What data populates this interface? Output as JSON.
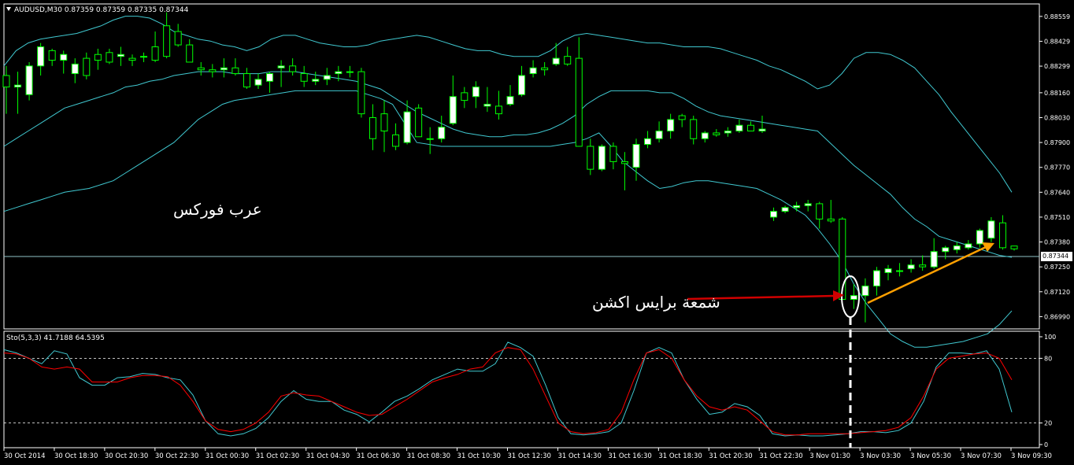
{
  "chart_header": {
    "symbol_info": "AUDUSD,M30  0.87359 0.87359 0.87335 0.87344"
  },
  "indicator_header": {
    "label": "Sto(5,3,3) 41.7188 64.5395"
  },
  "annotations": {
    "brand_text": "عرب فوركس",
    "price_action_label": "شمعة برايس اكشن"
  },
  "current_price_tag": "0.87344",
  "colors": {
    "background": "#000000",
    "bull_candle": "#ffffff",
    "bear_candle": "#000000",
    "wick": "#00ff00",
    "bollinger": "#40c8d0",
    "stoch_main": "#40c8d0",
    "stoch_signal": "#ff0000",
    "red_arrow": "#ff0000",
    "orange_arrow": "#ffa000",
    "grid_lines": "#ffffff"
  },
  "chart_data": [
    {
      "type": "candlestick",
      "title": "AUDUSD,M30",
      "y_ticks": [
        "0.88559",
        "0.88429",
        "0.88299",
        "0.88160",
        "0.88030",
        "0.87900",
        "0.87770",
        "0.87640",
        "0.87510",
        "0.87380",
        "0.87250",
        "0.87120",
        "0.86990"
      ],
      "ylim": [
        0.8693,
        0.8862
      ],
      "current_price": 0.87344,
      "x_tick_labels": [
        "30 Oct 2014",
        "30 Oct 18:30",
        "30 Oct 20:30",
        "30 Oct 22:30",
        "31 Oct 00:30",
        "31 Oct 02:30",
        "31 Oct 04:30",
        "31 Oct 06:30",
        "31 Oct 08:30",
        "31 Oct 10:30",
        "31 Oct 12:30",
        "31 Oct 14:30",
        "31 Oct 16:30",
        "31 Oct 18:30",
        "31 Oct 20:30",
        "31 Oct 22:30",
        "3 Nov 01:30",
        "3 Nov 03:30",
        "3 Nov 05:30",
        "3 Nov 07:30",
        "3 Nov 09:30"
      ],
      "candles": [
        [
          0.8825,
          0.883,
          0.8805,
          0.8819
        ],
        [
          0.8819,
          0.8827,
          0.8805,
          0.882
        ],
        [
          0.8815,
          0.8832,
          0.8812,
          0.883
        ],
        [
          0.883,
          0.8842,
          0.8825,
          0.884
        ],
        [
          0.8838,
          0.8839,
          0.883,
          0.8833
        ],
        [
          0.8833,
          0.8838,
          0.8826,
          0.8836
        ],
        [
          0.8826,
          0.8834,
          0.8821,
          0.8831
        ],
        [
          0.8834,
          0.8837,
          0.8823,
          0.8825
        ],
        [
          0.8836,
          0.8839,
          0.8828,
          0.8833
        ],
        [
          0.8837,
          0.8839,
          0.8831,
          0.8832
        ],
        [
          0.8835,
          0.884,
          0.883,
          0.8836
        ],
        [
          0.8834,
          0.8836,
          0.883,
          0.8833
        ],
        [
          0.8835,
          0.8837,
          0.8832,
          0.8835
        ],
        [
          0.884,
          0.8848,
          0.8832,
          0.8833
        ],
        [
          0.8851,
          0.8858,
          0.8834,
          0.8835
        ],
        [
          0.8848,
          0.8852,
          0.884,
          0.8841
        ],
        [
          0.8841,
          0.8844,
          0.8832,
          0.8832
        ],
        [
          0.8829,
          0.8832,
          0.8825,
          0.8828
        ],
        [
          0.8828,
          0.8831,
          0.8824,
          0.8827
        ],
        [
          0.8828,
          0.8834,
          0.8824,
          0.8829
        ],
        [
          0.8829,
          0.8834,
          0.8825,
          0.8826
        ],
        [
          0.8826,
          0.8829,
          0.8818,
          0.8819
        ],
        [
          0.882,
          0.8826,
          0.8818,
          0.8823
        ],
        [
          0.8822,
          0.8827,
          0.8816,
          0.8826
        ],
        [
          0.8829,
          0.8833,
          0.8819,
          0.883
        ],
        [
          0.883,
          0.8834,
          0.8825,
          0.8827
        ],
        [
          0.8826,
          0.883,
          0.8819,
          0.8822
        ],
        [
          0.8822,
          0.8827,
          0.882,
          0.8823
        ],
        [
          0.8823,
          0.8829,
          0.882,
          0.8825
        ],
        [
          0.8826,
          0.883,
          0.8822,
          0.8827
        ],
        [
          0.8827,
          0.883,
          0.8824,
          0.8827
        ],
        [
          0.8827,
          0.8829,
          0.8803,
          0.8805
        ],
        [
          0.8803,
          0.881,
          0.8786,
          0.8792
        ],
        [
          0.8805,
          0.8812,
          0.8785,
          0.8796
        ],
        [
          0.8794,
          0.88,
          0.8786,
          0.8788
        ],
        [
          0.879,
          0.8812,
          0.8789,
          0.8806
        ],
        [
          0.8808,
          0.881,
          0.8793,
          0.8793
        ],
        [
          0.8792,
          0.8798,
          0.8784,
          0.8792
        ],
        [
          0.8792,
          0.8804,
          0.879,
          0.8798
        ],
        [
          0.88,
          0.8825,
          0.8799,
          0.8814
        ],
        [
          0.8816,
          0.8819,
          0.8808,
          0.8812
        ],
        [
          0.8814,
          0.8822,
          0.8808,
          0.8819
        ],
        [
          0.8809,
          0.8819,
          0.8806,
          0.881
        ],
        [
          0.8809,
          0.8817,
          0.8802,
          0.8805
        ],
        [
          0.881,
          0.882,
          0.8809,
          0.8814
        ],
        [
          0.8815,
          0.883,
          0.8814,
          0.8825
        ],
        [
          0.8826,
          0.8833,
          0.8824,
          0.8829
        ],
        [
          0.8829,
          0.8832,
          0.8825,
          0.8828
        ],
        [
          0.8831,
          0.8842,
          0.883,
          0.8834
        ],
        [
          0.8835,
          0.884,
          0.883,
          0.8831
        ],
        [
          0.8834,
          0.8845,
          0.882,
          0.8788
        ],
        [
          0.8788,
          0.8792,
          0.8773,
          0.8776
        ],
        [
          0.8776,
          0.8789,
          0.8775,
          0.8788
        ],
        [
          0.8788,
          0.879,
          0.8776,
          0.878
        ],
        [
          0.878,
          0.8785,
          0.8765,
          0.8779
        ],
        [
          0.8777,
          0.8792,
          0.877,
          0.8789
        ],
        [
          0.8789,
          0.8796,
          0.8787,
          0.8792
        ],
        [
          0.8792,
          0.8801,
          0.879,
          0.8796
        ],
        [
          0.8796,
          0.8805,
          0.8792,
          0.8802
        ],
        [
          0.8804,
          0.8805,
          0.8798,
          0.8802
        ],
        [
          0.8802,
          0.8804,
          0.8789,
          0.8792
        ],
        [
          0.8792,
          0.8796,
          0.879,
          0.8795
        ],
        [
          0.8795,
          0.8797,
          0.8793,
          0.8794
        ],
        [
          0.8795,
          0.8798,
          0.8793,
          0.8796
        ],
        [
          0.8796,
          0.8802,
          0.8795,
          0.8799
        ],
        [
          0.8799,
          0.8801,
          0.8796,
          0.8796
        ],
        [
          0.8796,
          0.8804,
          0.8795,
          0.8797
        ],
        [
          0.8751,
          0.8756,
          0.8749,
          0.8754
        ],
        [
          0.8754,
          0.8757,
          0.8753,
          0.8756
        ],
        [
          0.8756,
          0.8759,
          0.8754,
          0.8757
        ],
        [
          0.8757,
          0.876,
          0.8754,
          0.8758
        ],
        [
          0.8758,
          0.8759,
          0.8745,
          0.875
        ],
        [
          0.875,
          0.876,
          0.8748,
          0.8749
        ],
        [
          0.875,
          0.8751,
          0.8708,
          0.8708
        ],
        [
          0.8708,
          0.8716,
          0.8703,
          0.871
        ],
        [
          0.871,
          0.8719,
          0.8696,
          0.8715
        ],
        [
          0.8715,
          0.8725,
          0.871,
          0.8723
        ],
        [
          0.8722,
          0.8726,
          0.8718,
          0.8724
        ],
        [
          0.8723,
          0.8727,
          0.872,
          0.8723
        ],
        [
          0.8724,
          0.8729,
          0.8722,
          0.8726
        ],
        [
          0.8726,
          0.8731,
          0.8723,
          0.8725
        ],
        [
          0.8725,
          0.874,
          0.8724,
          0.8733
        ],
        [
          0.8733,
          0.8736,
          0.8729,
          0.8735
        ],
        [
          0.8734,
          0.8738,
          0.8732,
          0.8736
        ],
        [
          0.8735,
          0.8739,
          0.8734,
          0.8737
        ],
        [
          0.8737,
          0.8745,
          0.8735,
          0.8744
        ],
        [
          0.874,
          0.8751,
          0.8738,
          0.8749
        ],
        [
          0.8748,
          0.8752,
          0.8734,
          0.8735
        ],
        [
          0.87359,
          0.87359,
          0.87335,
          0.87344
        ]
      ],
      "bollinger_upper": [
        0.883,
        0.8838,
        0.8842,
        0.8844,
        0.8845,
        0.8846,
        0.8847,
        0.8849,
        0.8851,
        0.8854,
        0.8856,
        0.8856,
        0.8855,
        0.8852,
        0.8848,
        0.8846,
        0.8844,
        0.8843,
        0.8841,
        0.884,
        0.8838,
        0.884,
        0.8844,
        0.8846,
        0.8846,
        0.8844,
        0.8842,
        0.8841,
        0.884,
        0.884,
        0.8841,
        0.8843,
        0.8844,
        0.8845,
        0.8846,
        0.8845,
        0.8843,
        0.8841,
        0.8839,
        0.8838,
        0.8838,
        0.8836,
        0.8835,
        0.8835,
        0.8835,
        0.8838,
        0.8843,
        0.8846,
        0.8847,
        0.8846,
        0.8845,
        0.8844,
        0.8843,
        0.8842,
        0.8842,
        0.8841,
        0.884,
        0.884,
        0.884,
        0.8839,
        0.8837,
        0.8835,
        0.8833,
        0.883,
        0.8828,
        0.8825,
        0.8822,
        0.8818,
        0.882,
        0.8826,
        0.8834,
        0.8837,
        0.8837,
        0.8836,
        0.8833,
        0.8829,
        0.8822,
        0.8815,
        0.8806,
        0.8798,
        0.879,
        0.8782,
        0.8774,
        0.8764
      ],
      "bollinger_middle": [
        0.8788,
        0.8792,
        0.8796,
        0.88,
        0.8804,
        0.8808,
        0.881,
        0.8812,
        0.8814,
        0.8816,
        0.8819,
        0.882,
        0.8822,
        0.8823,
        0.8825,
        0.8826,
        0.8827,
        0.8827,
        0.8827,
        0.8826,
        0.8826,
        0.8826,
        0.8827,
        0.8827,
        0.8827,
        0.8826,
        0.8825,
        0.8824,
        0.8823,
        0.8822,
        0.882,
        0.8818,
        0.8814,
        0.881,
        0.8806,
        0.8803,
        0.88,
        0.8797,
        0.8795,
        0.8794,
        0.8793,
        0.8793,
        0.8794,
        0.8794,
        0.8795,
        0.8797,
        0.88,
        0.8804,
        0.881,
        0.8814,
        0.8817,
        0.8817,
        0.8817,
        0.8817,
        0.8816,
        0.8816,
        0.8813,
        0.8809,
        0.8806,
        0.8804,
        0.8803,
        0.8802,
        0.8801,
        0.88,
        0.8799,
        0.8798,
        0.8797,
        0.8796,
        0.879,
        0.8784,
        0.8778,
        0.8773,
        0.8768,
        0.8763,
        0.8756,
        0.875,
        0.8746,
        0.8741,
        0.8739,
        0.8737,
        0.8735,
        0.8733,
        0.8731,
        0.873
      ],
      "bollinger_lower": [
        0.8754,
        0.8756,
        0.8758,
        0.876,
        0.8762,
        0.8764,
        0.8765,
        0.8766,
        0.8768,
        0.877,
        0.8774,
        0.8778,
        0.8782,
        0.8786,
        0.879,
        0.8796,
        0.8802,
        0.8806,
        0.881,
        0.8812,
        0.8813,
        0.8814,
        0.8815,
        0.8816,
        0.8817,
        0.8817,
        0.8817,
        0.8817,
        0.8817,
        0.8817,
        0.8815,
        0.8813,
        0.881,
        0.88,
        0.879,
        0.8789,
        0.8788,
        0.8788,
        0.8788,
        0.8788,
        0.8788,
        0.8788,
        0.8788,
        0.8788,
        0.8788,
        0.8788,
        0.8789,
        0.879,
        0.8792,
        0.8795,
        0.8788,
        0.878,
        0.8775,
        0.877,
        0.8766,
        0.8767,
        0.8769,
        0.877,
        0.877,
        0.8769,
        0.8768,
        0.8767,
        0.8766,
        0.8763,
        0.876,
        0.8756,
        0.8752,
        0.8745,
        0.8737,
        0.8728,
        0.8716,
        0.8706,
        0.8698,
        0.869,
        0.8686,
        0.8683,
        0.8683,
        0.8684,
        0.8685,
        0.8686,
        0.8688,
        0.869,
        0.8695,
        0.8702
      ]
    },
    {
      "type": "line",
      "title": "Sto(5,3,3)",
      "y_ticks": [
        "100",
        "80",
        "20",
        "0"
      ],
      "ylim": [
        0,
        100
      ],
      "levels": [
        80,
        20
      ],
      "series": [
        {
          "name": "Sto main",
          "values": [
            88,
            85,
            80,
            75,
            87,
            84,
            62,
            55,
            55,
            62,
            63,
            66,
            65,
            62,
            60,
            46,
            22,
            10,
            8,
            10,
            15,
            25,
            40,
            50,
            42,
            40,
            40,
            32,
            28,
            21,
            30,
            40,
            45,
            52,
            60,
            65,
            70,
            68,
            68,
            75,
            95,
            90,
            82,
            55,
            25,
            10,
            9,
            10,
            12,
            20,
            50,
            85,
            90,
            85,
            60,
            42,
            28,
            30,
            38,
            35,
            27,
            10,
            8,
            9,
            8,
            8,
            9,
            10,
            12,
            12,
            11,
            13,
            20,
            40,
            72,
            85,
            85,
            84,
            87,
            70,
            30
          ],
          "color": "#40c8d0"
        },
        {
          "name": "Sto signal",
          "values": [
            85,
            84,
            80,
            72,
            70,
            72,
            70,
            58,
            58,
            58,
            62,
            64,
            64,
            63,
            55,
            40,
            22,
            14,
            12,
            14,
            20,
            30,
            45,
            48,
            46,
            45,
            40,
            35,
            30,
            27,
            28,
            35,
            42,
            50,
            58,
            62,
            65,
            70,
            72,
            85,
            90,
            88,
            70,
            45,
            20,
            12,
            10,
            11,
            14,
            30,
            60,
            85,
            88,
            80,
            60,
            45,
            35,
            32,
            35,
            32,
            22,
            12,
            9,
            9,
            10,
            10,
            10,
            10,
            11,
            12,
            13,
            16,
            25,
            45,
            70,
            80,
            82,
            84,
            85,
            80,
            60
          ],
          "color": "#ff0000"
        }
      ]
    }
  ]
}
